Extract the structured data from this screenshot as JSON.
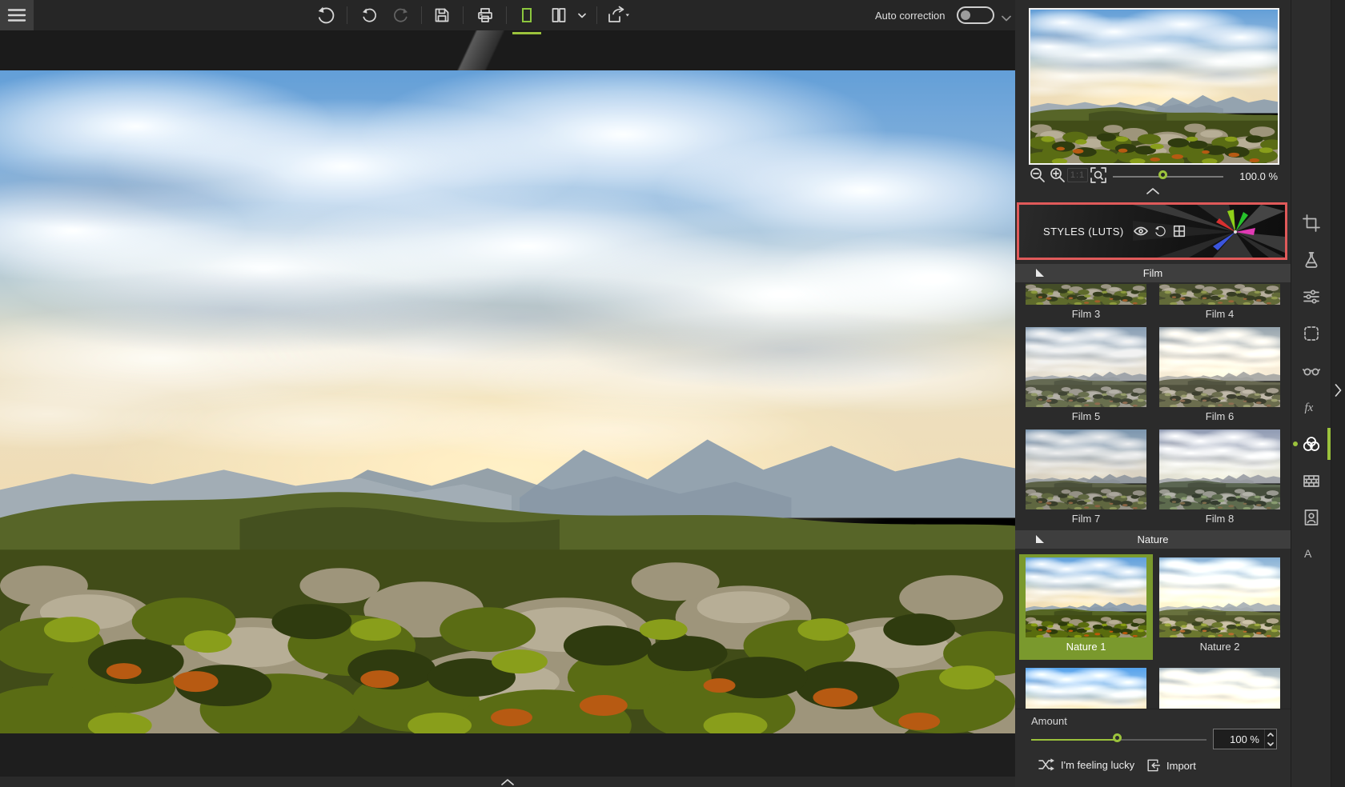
{
  "toolbar": {
    "auto_correction_label": "Auto correction",
    "auto_correction_state": "off",
    "icons": [
      "menu",
      "revert",
      "undo",
      "redo",
      "save",
      "print",
      "view-single",
      "view-split",
      "dropdown-chevron",
      "share"
    ],
    "active_view": "view-single"
  },
  "navigator": {
    "zoom_value": "100.0 %",
    "icons": [
      "zoom-out",
      "zoom-in",
      "one-to-one",
      "zoom-fit"
    ],
    "one_to_one_label": "1:1"
  },
  "styles_panel": {
    "title": "STYLES (LUTS)",
    "header_icons": [
      "visibility",
      "reset",
      "grid-view"
    ],
    "highlighted": true,
    "sections": [
      {
        "label": "Film",
        "items": [
          {
            "label": "Film 3",
            "clip": "top"
          },
          {
            "label": "Film 4",
            "clip": "top"
          },
          {
            "label": "Film 5"
          },
          {
            "label": "Film 6"
          },
          {
            "label": "Film 7"
          },
          {
            "label": "Film 8"
          }
        ]
      },
      {
        "label": "Nature",
        "items": [
          {
            "label": "Nature 1",
            "selected": true
          },
          {
            "label": "Nature 2"
          },
          {
            "label": "",
            "clip": "bottom"
          },
          {
            "label": "",
            "clip": "bottom"
          }
        ]
      }
    ],
    "amount": {
      "label": "Amount",
      "value": "100 %",
      "percent": 100
    },
    "buttons": {
      "lucky": "I'm feeling lucky",
      "import": "Import"
    }
  },
  "tool_strip": {
    "items": [
      {
        "name": "crop"
      },
      {
        "name": "develop-flask"
      },
      {
        "name": "adjustments-sliders"
      },
      {
        "name": "selection"
      },
      {
        "name": "preview-glasses"
      },
      {
        "name": "effects-fx"
      },
      {
        "name": "styles-luts",
        "active": true
      },
      {
        "name": "texture-bricks"
      },
      {
        "name": "frame-portrait"
      },
      {
        "name": "typography"
      }
    ]
  },
  "colors": {
    "accent_green": "#9bc23c",
    "selected_green": "#7a992d",
    "highlight_red": "#e05a5a"
  }
}
